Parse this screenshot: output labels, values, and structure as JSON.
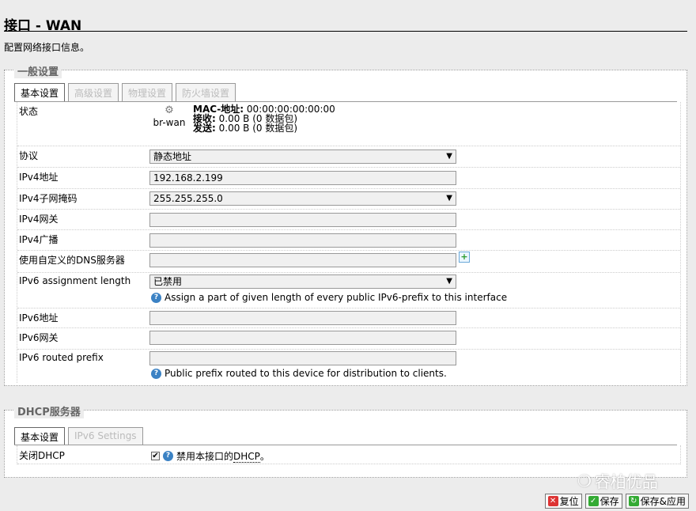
{
  "header": {
    "title": "接口 - WAN",
    "description": "配置网络接口信息。"
  },
  "general": {
    "legend": "一般设置",
    "tabs": [
      "基本设置",
      "高级设置",
      "物理设置",
      "防火墙设置"
    ],
    "status": {
      "label": "状态",
      "iface_name": "br-wan",
      "mac_label": "MAC-地址:",
      "mac_value": "00:00:00:00:00:00",
      "rx_label": "接收:",
      "rx_value": "0.00 B (0 数据包)",
      "tx_label": "发送:",
      "tx_value": "0.00 B (0 数据包)"
    },
    "protocol": {
      "label": "协议",
      "value": "静态地址"
    },
    "ipv4_addr": {
      "label": "IPv4地址",
      "value": "192.168.2.199"
    },
    "ipv4_mask": {
      "label": "IPv4子网掩码",
      "value": "255.255.255.0"
    },
    "ipv4_gw": {
      "label": "IPv4网关",
      "value": ""
    },
    "ipv4_bcast": {
      "label": "IPv4广播",
      "value": ""
    },
    "dns": {
      "label": "使用自定义的DNS服务器",
      "value": ""
    },
    "ipv6_assign": {
      "label": "IPv6 assignment length",
      "value": "已禁用",
      "hint": "Assign a part of given length of every public IPv6-prefix to this interface"
    },
    "ipv6_addr": {
      "label": "IPv6地址",
      "value": ""
    },
    "ipv6_gw": {
      "label": "IPv6网关",
      "value": ""
    },
    "ipv6_prefix": {
      "label": "IPv6 routed prefix",
      "value": "",
      "hint": "Public prefix routed to this device for distribution to clients."
    }
  },
  "dhcp": {
    "legend": "DHCP服务器",
    "tabs": [
      "基本设置",
      "IPv6 Settings"
    ],
    "disable": {
      "label": "关闭DHCP",
      "checked": true,
      "hint_prefix": "禁用本接口的",
      "hint_abbr": "DHCP",
      "hint_suffix": "。"
    }
  },
  "watermark": "睿柏优品",
  "buttons": {
    "reset": "复位",
    "save": "保存",
    "save_apply": "保存&应用"
  }
}
